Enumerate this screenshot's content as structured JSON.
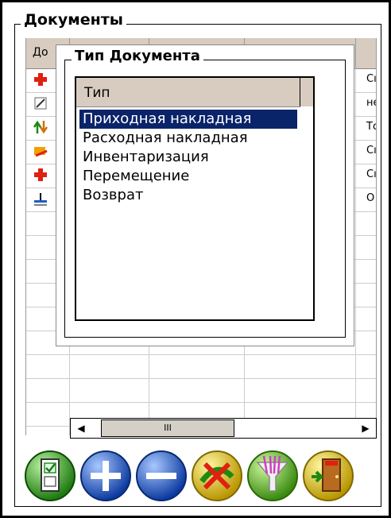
{
  "window": {
    "group_title": "Документы"
  },
  "grid": {
    "header_col1": "До",
    "rows": [
      {
        "icon": "red-cross-icon",
        "text": "Сı"
      },
      {
        "icon": "edit-icon",
        "text": "не"
      },
      {
        "icon": "arrows-updown-icon",
        "text": "То"
      },
      {
        "icon": "transfer-icon",
        "text": "Сı"
      },
      {
        "icon": "red-cross-icon",
        "text": "Сı"
      },
      {
        "icon": "return-icon",
        "text": "О"
      }
    ]
  },
  "scrollbar": {
    "left_arrow": "◀",
    "thumb_label": "III",
    "right_arrow": "▶"
  },
  "dialog": {
    "title": "Тип Документа",
    "column_header": "Тип",
    "items": [
      "Приходная накладная",
      "Расходная накладная",
      "Инвентаризация",
      "Перемещение",
      "Возврат"
    ],
    "selected_index": 0
  },
  "toolbar": {
    "buttons": [
      {
        "name": "checklist-button",
        "color": "#3a9b2a"
      },
      {
        "name": "add-button",
        "color": "#1f5bd0"
      },
      {
        "name": "remove-button",
        "color": "#1f5bd0"
      },
      {
        "name": "delete-button",
        "color": "#d4b800"
      },
      {
        "name": "filter-button",
        "color": "#5aaa2a"
      },
      {
        "name": "exit-button",
        "color": "#d4b800"
      }
    ]
  },
  "colors": {
    "header_bg": "#d8ccc0",
    "selection": "#0a246a"
  }
}
